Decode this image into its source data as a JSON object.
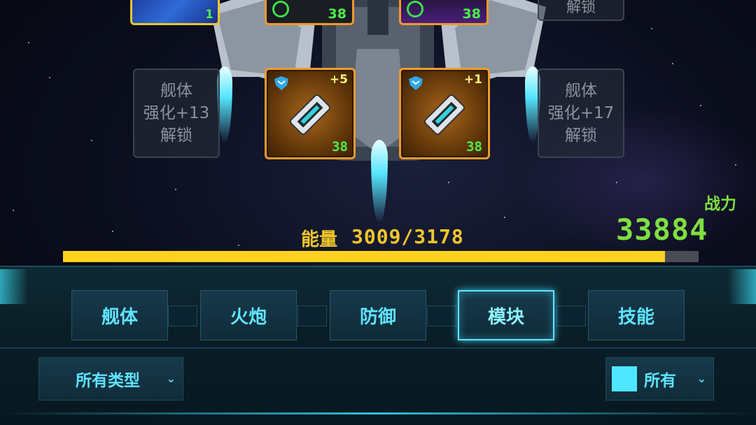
{
  "slots": {
    "top_left_level": "1",
    "top_mid1_level": "38",
    "top_mid2_level": "38",
    "top_right_text": "解锁",
    "left_locked": "舰体\n强化+13\n解锁",
    "right_locked": "舰体\n强化+17\n解锁",
    "module_a": {
      "plus": "+5",
      "level": "38"
    },
    "module_b": {
      "plus": "+1",
      "level": "38"
    }
  },
  "energy": {
    "label": "能量",
    "value": "3009/3178",
    "current": 3009,
    "max": 3178
  },
  "power": {
    "label": "战力",
    "value": "33884"
  },
  "tabs": [
    {
      "label": "舰体"
    },
    {
      "label": "火炮"
    },
    {
      "label": "防御"
    },
    {
      "label": "模块"
    },
    {
      "label": "技能"
    }
  ],
  "active_tab": "模块",
  "filters": {
    "type_label": "所有类型",
    "color_label": "所有",
    "swatch_color": "#4fe7ff"
  },
  "colors": {
    "accent": "#5fe4ff",
    "energy": "#ffd21e",
    "power": "#7ee040",
    "level": "#4ef04a"
  }
}
